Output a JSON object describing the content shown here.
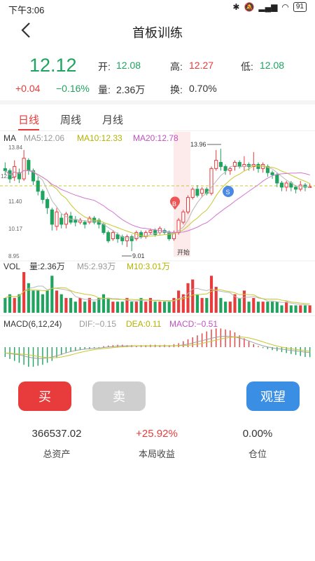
{
  "status_bar": {
    "time": "下午3:06",
    "battery": "91"
  },
  "header": {
    "title": "首板训练"
  },
  "quote": {
    "price": "12.12",
    "change": "+0.04",
    "change_pct": "−0.16%",
    "open_label": "开:",
    "open": "12.08",
    "high_label": "高:",
    "high": "12.27",
    "low_label": "低:",
    "low": "12.08",
    "volume_label": "量:",
    "volume": "2.36万",
    "turnover_label": "换:",
    "turnover": "0.70%"
  },
  "tabs": [
    {
      "label": "日线",
      "active": true
    },
    {
      "label": "周线",
      "active": false
    },
    {
      "label": "月线",
      "active": false
    }
  ],
  "chart_data": {
    "type": "candlestick",
    "ma_legend": {
      "title": "MA",
      "ma5": "MA5:12.06",
      "ma10": "MA10:12.33",
      "ma20": "MA20:12.78"
    },
    "price_ticks": [
      "13.84",
      "12.62",
      "11.40",
      "10.17",
      "8.95"
    ],
    "annotations": {
      "high": "13.96",
      "low": "9.01",
      "start": "开始",
      "buy": "B",
      "sell": "S"
    },
    "vol_legend": {
      "title": "VOL",
      "vol": "量:2.36万",
      "m5": "M5:2.93万",
      "m10": "M10:3.01万"
    },
    "macd_legend": {
      "title": "MACD(6,12,24)",
      "dif": "DIF:−0.15",
      "dea": "DEA:0.11",
      "macd": "MACD:−0.51"
    },
    "price_range": [
      8.95,
      13.84
    ],
    "candles": [
      [
        13.0,
        12.9,
        13.3,
        12.7
      ],
      [
        12.9,
        12.5,
        13.0,
        12.3
      ],
      [
        12.6,
        13.1,
        13.4,
        12.4
      ],
      [
        12.8,
        12.5,
        13.0,
        12.3
      ],
      [
        12.5,
        13.5,
        13.9,
        12.4
      ],
      [
        13.4,
        12.9,
        13.5,
        12.7
      ],
      [
        12.9,
        12.4,
        13.0,
        12.2
      ],
      [
        12.4,
        11.9,
        12.6,
        11.7
      ],
      [
        11.9,
        11.5,
        12.0,
        11.3
      ],
      [
        11.5,
        11.1,
        11.6,
        10.8
      ],
      [
        11.0,
        10.3,
        11.1,
        10.0
      ],
      [
        10.2,
        10.9,
        11.1,
        10.0
      ],
      [
        10.6,
        10.3,
        10.8,
        10.1
      ],
      [
        10.3,
        10.8,
        10.9,
        10.1
      ],
      [
        10.7,
        10.4,
        10.9,
        10.3
      ],
      [
        10.5,
        10.4,
        10.7,
        10.2
      ],
      [
        10.4,
        10.5,
        10.6,
        10.3
      ],
      [
        10.4,
        10.3,
        10.5,
        10.1
      ],
      [
        10.4,
        10.6,
        10.7,
        10.3
      ],
      [
        10.6,
        10.4,
        10.7,
        10.3
      ],
      [
        10.5,
        10.3,
        10.6,
        10.1
      ],
      [
        10.3,
        9.9,
        10.4,
        9.8
      ],
      [
        9.9,
        9.5,
        10.0,
        9.4
      ],
      [
        9.6,
        9.9,
        10.0,
        9.5
      ],
      [
        9.8,
        9.6,
        9.9,
        9.4
      ],
      [
        9.7,
        9.5,
        9.8,
        9.3
      ],
      [
        9.5,
        9.7,
        9.8,
        9.2
      ],
      [
        9.7,
        9.5,
        9.8,
        9.0
      ],
      [
        9.6,
        9.9,
        10.0,
        9.5
      ],
      [
        9.9,
        9.7,
        10.0,
        9.6
      ],
      [
        9.7,
        9.9,
        10.0,
        9.6
      ],
      [
        9.9,
        10.0,
        10.1,
        9.8
      ],
      [
        10.0,
        9.8,
        10.1,
        9.7
      ],
      [
        9.9,
        10.1,
        10.2,
        9.8
      ],
      [
        10.0,
        9.9,
        10.1,
        9.8
      ],
      [
        9.9,
        9.6,
        10.0,
        9.5
      ],
      [
        9.6,
        9.9,
        10.0,
        9.5
      ],
      [
        9.9,
        10.5,
        10.6,
        9.8
      ],
      [
        10.4,
        10.9,
        11.0,
        10.3
      ],
      [
        10.9,
        11.6,
        11.7,
        10.8
      ],
      [
        11.6,
        12.0,
        12.1,
        11.5
      ],
      [
        12.0,
        11.7,
        12.2,
        11.6
      ],
      [
        11.8,
        12.0,
        12.1,
        11.6
      ],
      [
        12.0,
        11.8,
        12.1,
        11.7
      ],
      [
        11.8,
        13.0,
        13.1,
        11.7
      ],
      [
        13.0,
        13.4,
        13.9,
        12.9
      ],
      [
        13.3,
        13.1,
        13.96,
        12.9
      ],
      [
        13.1,
        12.9,
        13.2,
        12.7
      ],
      [
        12.9,
        13.0,
        13.1,
        12.7
      ],
      [
        13.1,
        13.3,
        13.4,
        12.9
      ],
      [
        13.3,
        13.1,
        13.4,
        13.0
      ],
      [
        13.1,
        13.2,
        13.6,
        12.9
      ],
      [
        13.2,
        13.1,
        13.3,
        12.9
      ],
      [
        13.1,
        13.2,
        13.8,
        12.9
      ],
      [
        13.2,
        13.0,
        13.3,
        12.8
      ],
      [
        13.0,
        13.2,
        13.3,
        12.8
      ],
      [
        13.1,
        12.8,
        13.2,
        12.6
      ],
      [
        12.8,
        12.7,
        12.9,
        12.5
      ],
      [
        12.7,
        12.3,
        12.8,
        12.1
      ],
      [
        12.3,
        12.1,
        12.4,
        11.9
      ],
      [
        12.1,
        12.3,
        12.4,
        11.9
      ],
      [
        12.3,
        12.1,
        12.4,
        11.9
      ],
      [
        12.1,
        12.0,
        12.2,
        11.8
      ],
      [
        12.0,
        12.2,
        12.4,
        11.9
      ],
      [
        12.2,
        12.1,
        12.3,
        11.9
      ],
      [
        12.1,
        12.12,
        12.27,
        12.08
      ]
    ],
    "volumes": [
      [
        4,
        0
      ],
      [
        5,
        0
      ],
      [
        4,
        1
      ],
      [
        5,
        0
      ],
      [
        11,
        1
      ],
      [
        8,
        0
      ],
      [
        6,
        0
      ],
      [
        6,
        0
      ],
      [
        5,
        0
      ],
      [
        6,
        0
      ],
      [
        10,
        0
      ],
      [
        6,
        1
      ],
      [
        5,
        0
      ],
      [
        4,
        1
      ],
      [
        4,
        0
      ],
      [
        3,
        0
      ],
      [
        4,
        1
      ],
      [
        3,
        0
      ],
      [
        4,
        1
      ],
      [
        3,
        0
      ],
      [
        4,
        0
      ],
      [
        5,
        0
      ],
      [
        4,
        0
      ],
      [
        3,
        1
      ],
      [
        3,
        0
      ],
      [
        3,
        0
      ],
      [
        4,
        1
      ],
      [
        3,
        0
      ],
      [
        3,
        1
      ],
      [
        4,
        0
      ],
      [
        3,
        1
      ],
      [
        4,
        1
      ],
      [
        3,
        0
      ],
      [
        3,
        1
      ],
      [
        3,
        0
      ],
      [
        3,
        0
      ],
      [
        4,
        1
      ],
      [
        6,
        1
      ],
      [
        5,
        1
      ],
      [
        8,
        1
      ],
      [
        9,
        1
      ],
      [
        5,
        0
      ],
      [
        4,
        1
      ],
      [
        4,
        0
      ],
      [
        10,
        1
      ],
      [
        7,
        1
      ],
      [
        4,
        0
      ],
      [
        3,
        0
      ],
      [
        3,
        1
      ],
      [
        5,
        1
      ],
      [
        4,
        0
      ],
      [
        6,
        1
      ],
      [
        3,
        0
      ],
      [
        4,
        1
      ],
      [
        3,
        0
      ],
      [
        3,
        1
      ],
      [
        3,
        0
      ],
      [
        3,
        0
      ],
      [
        3,
        0
      ],
      [
        2,
        0
      ],
      [
        3,
        1
      ],
      [
        2,
        0
      ],
      [
        2,
        0
      ],
      [
        2,
        1
      ],
      [
        2,
        0
      ],
      [
        2,
        1
      ]
    ],
    "macd": [
      -0.5,
      -0.6,
      -0.7,
      -0.8,
      -0.9,
      -1.0,
      -1.0,
      -0.95,
      -0.9,
      -0.8,
      -0.7,
      -0.55,
      -0.4,
      -0.3,
      -0.25,
      -0.2,
      -0.15,
      -0.1,
      -0.1,
      -0.05,
      -0.03,
      0.05,
      0.08,
      0.1,
      0.12,
      0.12,
      0.1,
      0.1,
      0.08,
      0.1,
      0.1,
      0.12,
      0.12,
      0.1,
      0.12,
      0.1,
      0.15,
      0.2,
      0.3,
      0.4,
      0.5,
      0.6,
      0.7,
      0.8,
      0.9,
      0.95,
      0.95,
      0.9,
      0.85,
      0.75,
      0.6,
      0.45,
      0.3,
      0.15,
      0.05,
      -0.05,
      -0.1,
      -0.15,
      -0.2,
      -0.25,
      -0.3,
      -0.35,
      -0.4,
      -0.45,
      -0.5,
      -0.51
    ]
  },
  "actions": {
    "buy": "买",
    "sell": "卖",
    "watch": "观望"
  },
  "stats": [
    {
      "value": "366537.02",
      "label": "总资产"
    },
    {
      "value": "+25.92%",
      "label": "本局收益"
    },
    {
      "value": "0.00%",
      "label": "仓位"
    }
  ],
  "colors": {
    "up": "#e83b3b",
    "down": "#1fa35f",
    "ma5": "#c8c832",
    "ma10": "#c8c832",
    "ma20": "#d277d2",
    "macd_dif": "#a0a0a0",
    "buy_btn": "#e83b3b",
    "sell_btn": "#cfcfcf",
    "watch_btn": "#3a8fe5"
  }
}
